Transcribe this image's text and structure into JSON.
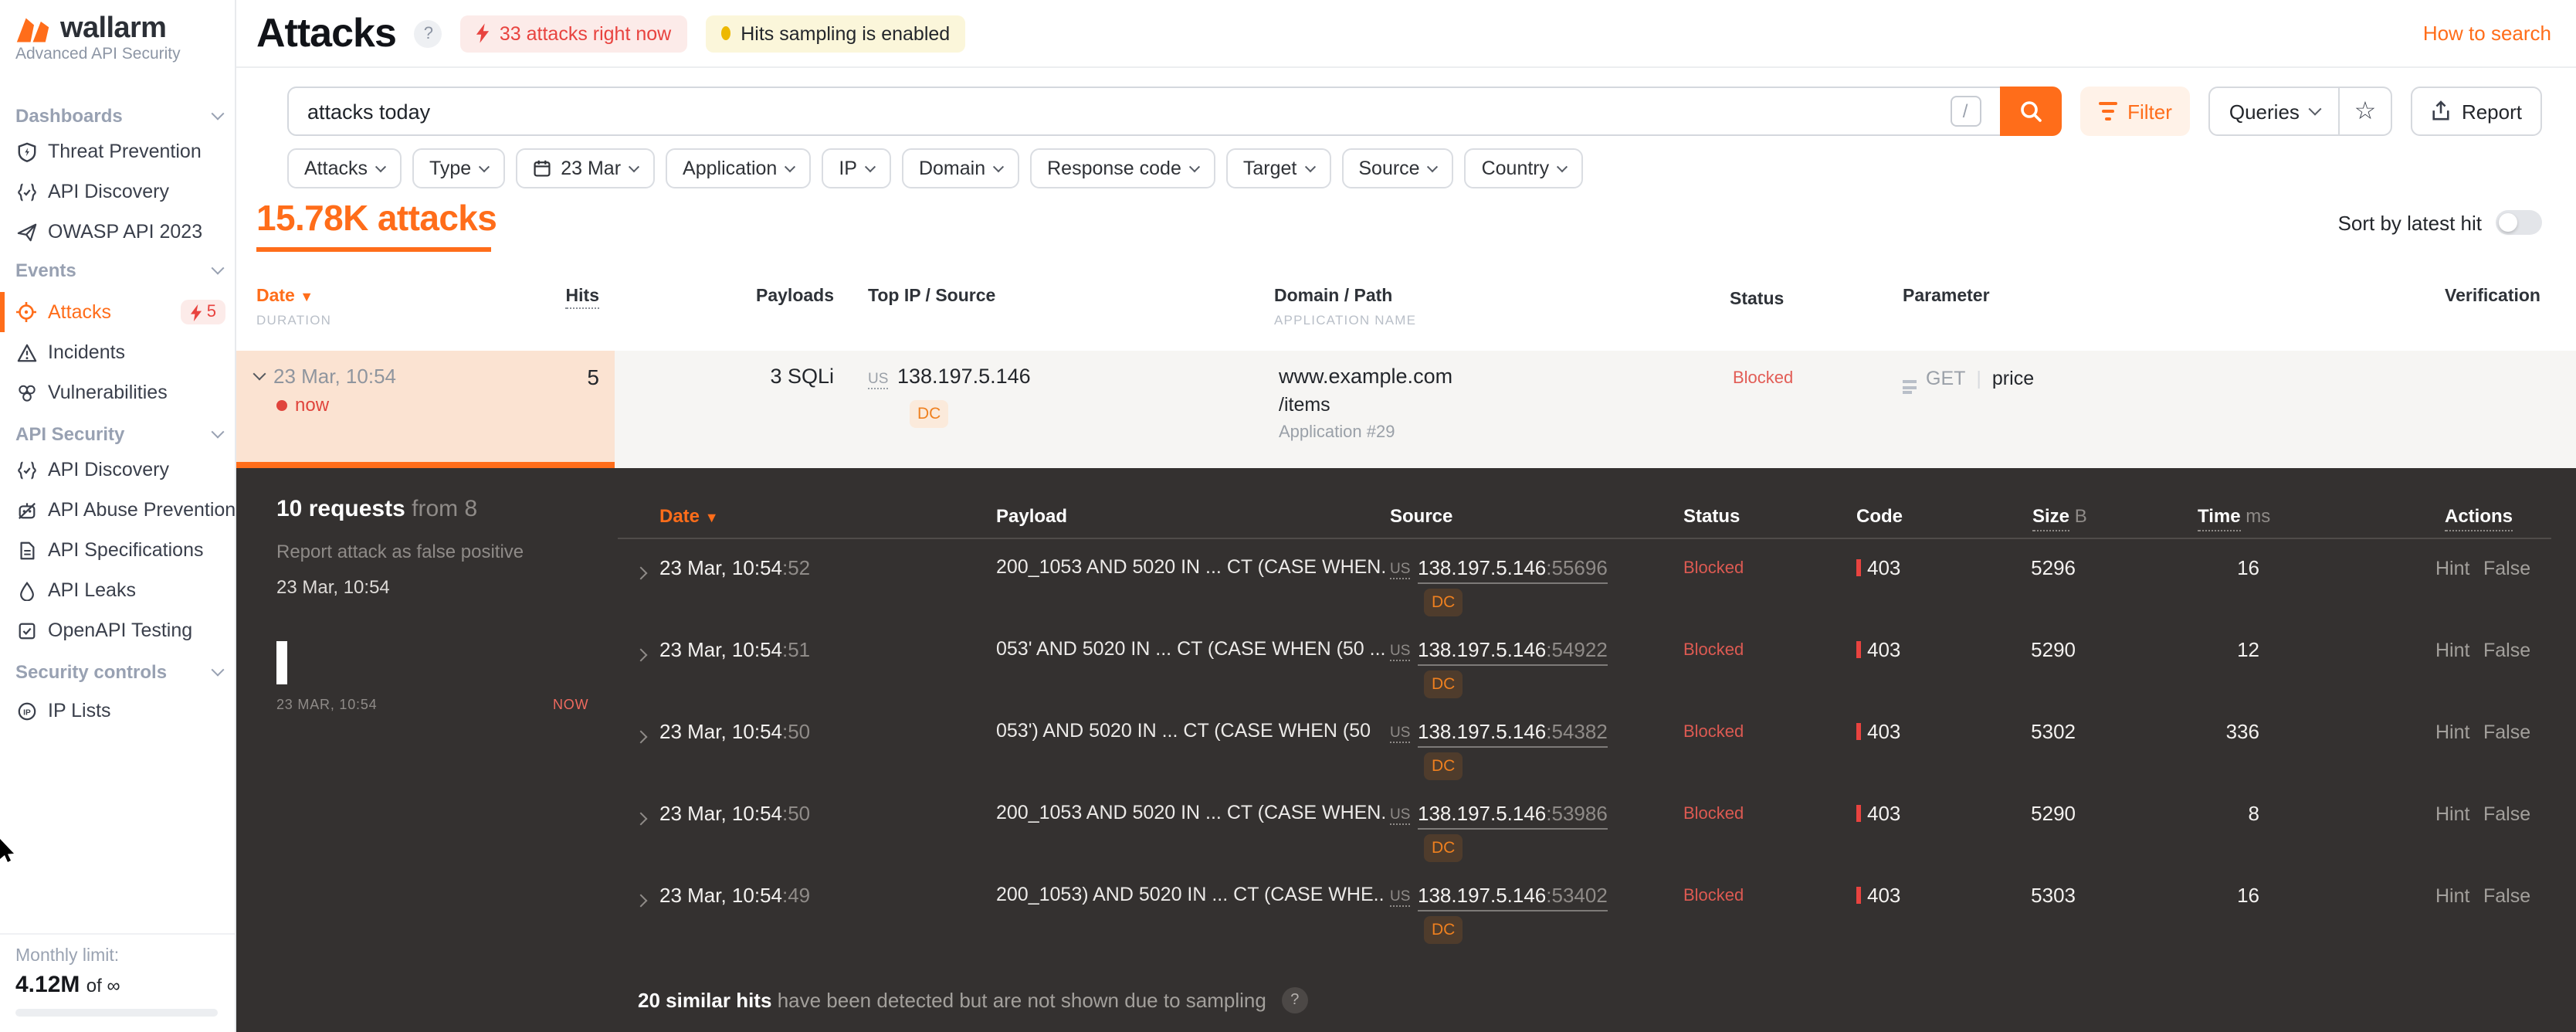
{
  "sidebar": {
    "brand": "wallarm",
    "subtitle": "Advanced API Security",
    "sections": [
      {
        "label": "Dashboards",
        "items": [
          {
            "label": "Threat Prevention"
          },
          {
            "label": "API Discovery"
          },
          {
            "label": "OWASP API 2023"
          }
        ]
      },
      {
        "label": "Events",
        "items": [
          {
            "label": "Attacks",
            "badge": "5"
          },
          {
            "label": "Incidents"
          },
          {
            "label": "Vulnerabilities"
          }
        ]
      },
      {
        "label": "API Security",
        "items": [
          {
            "label": "API Discovery"
          },
          {
            "label": "API Abuse Prevention"
          },
          {
            "label": "API Specifications"
          },
          {
            "label": "API Leaks"
          },
          {
            "label": "OpenAPI Testing"
          }
        ]
      },
      {
        "label": "Security controls",
        "items": [
          {
            "label": "IP Lists"
          }
        ]
      }
    ],
    "monthly": {
      "label": "Monthly limit:",
      "used": "4.12M",
      "of": "of",
      "total": "∞"
    }
  },
  "header": {
    "title": "Attacks",
    "help": "?",
    "alert_badge": "33 attacks right now",
    "sampling_badge": "Hits sampling is enabled",
    "how_to_search": "How to search"
  },
  "search": {
    "value": "attacks today",
    "shortcut": "/"
  },
  "toolbar": {
    "filter": "Filter",
    "queries": "Queries",
    "star": "☆",
    "report": "Report"
  },
  "filters": {
    "attacks": "Attacks",
    "type": "Type",
    "date": "23 Mar",
    "application": "Application",
    "ip": "IP",
    "domain": "Domain",
    "response_code": "Response code",
    "target": "Target",
    "source": "Source",
    "country": "Country"
  },
  "summary": {
    "count": "15.78K attacks",
    "sort_label": "Sort by latest hit"
  },
  "attacks_table": {
    "headers": {
      "date": "Date",
      "duration": "DURATION",
      "hits": "Hits",
      "payloads": "Payloads",
      "top_ip": "Top IP / Source",
      "domain_path": "Domain / Path",
      "application_name": "APPLICATION NAME",
      "status": "Status",
      "parameter": "Parameter",
      "verification": "Verification"
    },
    "row": {
      "date": "23 Mar, 10:54",
      "now": "now",
      "hits": "5",
      "payloads": "3 SQLi",
      "country": "US",
      "ip": "138.197.5.146",
      "dc": "DC",
      "domain": "www.example.com",
      "path": "/items",
      "application": "Application #29",
      "status": "Blocked",
      "method": "GET",
      "parameter": "price"
    }
  },
  "detail_panel": {
    "requests_bold": "10 requests",
    "requests_from": "from 8",
    "report_link": "Report attack as false positive",
    "time": "23 Mar, 10:54",
    "timeline": {
      "start": "23 MAR, 10:54",
      "end": "NOW"
    },
    "headers": {
      "date": "Date",
      "payload": "Payload",
      "source": "Source",
      "status": "Status",
      "code": "Code",
      "size": "Size",
      "size_unit": "B",
      "time": "Time",
      "time_unit": "ms",
      "actions": "Actions"
    },
    "rows": [
      {
        "date": "23 Mar, 10:54",
        "sec": ":52",
        "payload": "200_1053 AND 5020 IN ... CT (CASE WHEN...",
        "country": "US",
        "ip": "138.197.5.146",
        "port": ":55696",
        "dc": "DC",
        "status": "Blocked",
        "code": "403",
        "size": "5296",
        "time": "16",
        "hint_label": "Hint",
        "false_label": "False"
      },
      {
        "date": "23 Mar, 10:54",
        "sec": ":51",
        "payload": "053' AND 5020 IN ... CT (CASE WHEN (50 ....",
        "country": "US",
        "ip": "138.197.5.146",
        "port": ":54922",
        "dc": "DC",
        "status": "Blocked",
        "code": "403",
        "size": "5290",
        "time": "12",
        "hint_label": "Hint",
        "false_label": "False"
      },
      {
        "date": "23 Mar, 10:54",
        "sec": ":50",
        "payload": "053') AND 5020 IN ... CT (CASE WHEN (50",
        "country": "US",
        "ip": "138.197.5.146",
        "port": ":54382",
        "dc": "DC",
        "status": "Blocked",
        "code": "403",
        "size": "5302",
        "time": "336",
        "hint_label": "Hint",
        "false_label": "False"
      },
      {
        "date": "23 Mar, 10:54",
        "sec": ":50",
        "payload": "200_1053 AND 5020 IN ... CT (CASE WHEN...",
        "country": "US",
        "ip": "138.197.5.146",
        "port": ":53986",
        "dc": "DC",
        "status": "Blocked",
        "code": "403",
        "size": "5290",
        "time": "8",
        "hint_label": "Hint",
        "false_label": "False"
      },
      {
        "date": "23 Mar, 10:54",
        "sec": ":49",
        "payload": "200_1053) AND 5020 IN ... CT (CASE WHE...",
        "country": "US",
        "ip": "138.197.5.146",
        "port": ":53402",
        "dc": "DC",
        "status": "Blocked",
        "code": "403",
        "size": "5303",
        "time": "16",
        "hint_label": "Hint",
        "false_label": "False"
      }
    ],
    "sampling": {
      "bold": "20 similar hits",
      "rest": "have been detected but are not shown due to sampling",
      "help": "?"
    }
  }
}
